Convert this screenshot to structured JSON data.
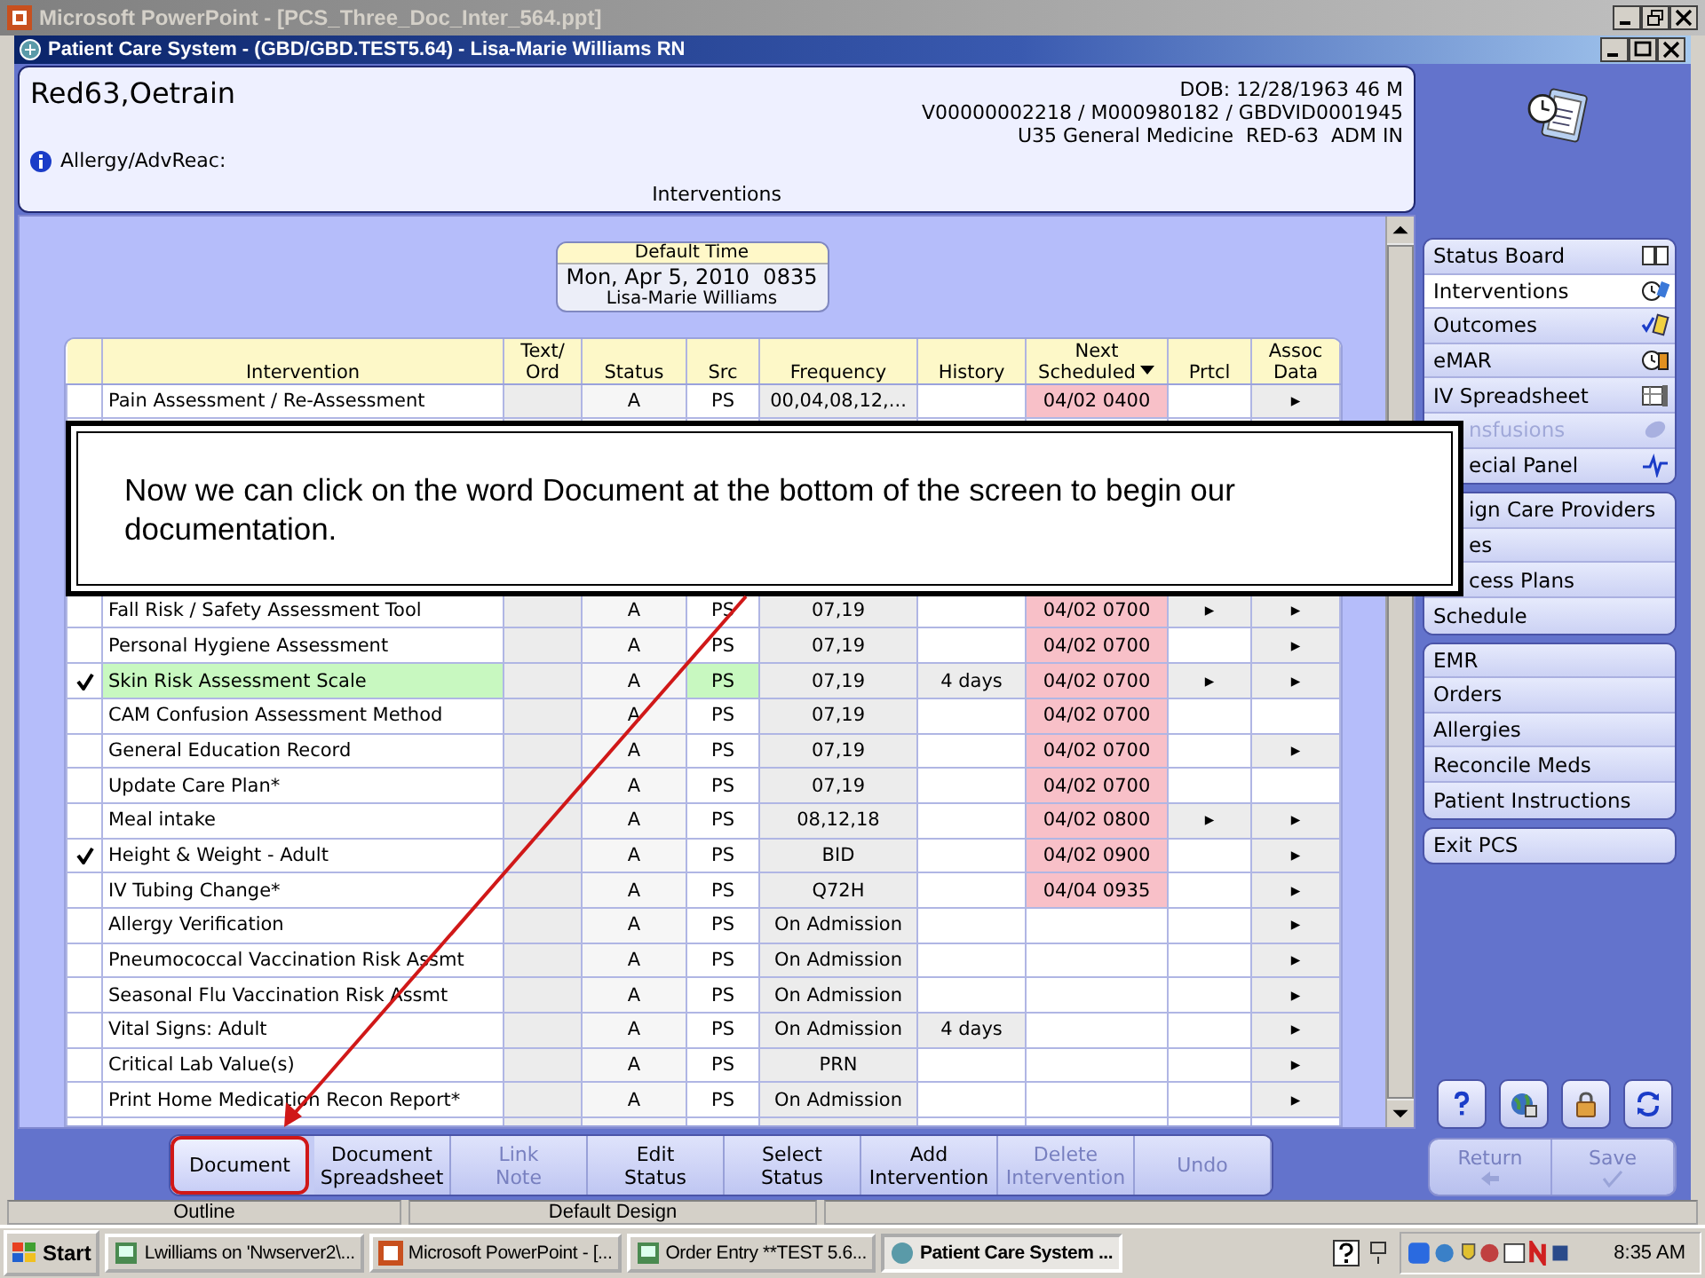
{
  "ppt_window": {
    "title": "Microsoft PowerPoint - [PCS_Three_Doc_Inter_564.ppt]"
  },
  "app_window": {
    "title": "Patient Care System - (GBD/GBD.TEST5.64) - Lisa-Marie Williams RN"
  },
  "patient": {
    "name": "Red63,Oetrain",
    "dob": "DOB: 12/28/1963 46 M",
    "ids": "V00000002218 / M000980182 / GBDVID0001945",
    "location": "U35 General Medicine  RED-63  ADM IN",
    "allergy_label": "Allergy/AdvReac:"
  },
  "page_title": "Interventions",
  "default_time": {
    "label": "Default Time",
    "datetime": "Mon, Apr 5, 2010  0835",
    "user": "Lisa-Marie Williams"
  },
  "table": {
    "columns": [
      {
        "label": "Intervention"
      },
      {
        "label": "Text/\nOrd"
      },
      {
        "label": "Status"
      },
      {
        "label": "Src"
      },
      {
        "label": "Frequency"
      },
      {
        "label": "History"
      },
      {
        "label": "Next\nScheduled",
        "sorted": true
      },
      {
        "label": "Prtcl"
      },
      {
        "label": "Assoc\nData"
      }
    ],
    "rows": [
      {
        "checked": false,
        "selected": false,
        "intervention": "Pain Assessment / Re-Assessment",
        "status": "A",
        "src": "PS",
        "frequency": "00,04,08,12,...",
        "next_scheduled": "04/02 0400",
        "assoc_data": "▸"
      },
      {
        "checked": false,
        "selected": false,
        "intervention": "Fall Risk / Safety Assessment Tool",
        "status": "A",
        "src": "PS",
        "frequency": "07,19",
        "next_scheduled": "04/02 0700",
        "prtcl": "▸",
        "assoc_data": "▸"
      },
      {
        "checked": false,
        "selected": false,
        "intervention": "Personal Hygiene Assessment",
        "status": "A",
        "src": "PS",
        "frequency": "07,19",
        "next_scheduled": "04/02 0700",
        "assoc_data": "▸"
      },
      {
        "checked": true,
        "selected": true,
        "intervention": "Skin Risk Assessment Scale",
        "status": "A",
        "src": "PS",
        "frequency": "07,19",
        "history": "4 days",
        "next_scheduled": "04/02 0700",
        "prtcl": "▸",
        "assoc_data": "▸"
      },
      {
        "checked": false,
        "selected": false,
        "intervention": "CAM Confusion Assessment Method",
        "status": "A",
        "src": "PS",
        "frequency": "07,19",
        "next_scheduled": "04/02 0700"
      },
      {
        "checked": false,
        "selected": false,
        "intervention": "General Education Record",
        "status": "A",
        "src": "PS",
        "frequency": "07,19",
        "next_scheduled": "04/02 0700",
        "assoc_data": "▸"
      },
      {
        "checked": false,
        "selected": false,
        "intervention": "Update Care Plan*",
        "status": "A",
        "src": "PS",
        "frequency": "07,19",
        "next_scheduled": "04/02 0700"
      },
      {
        "checked": false,
        "selected": false,
        "intervention": "Meal intake",
        "status": "A",
        "src": "PS",
        "frequency": "08,12,18",
        "next_scheduled": "04/02 0800",
        "prtcl": "▸",
        "assoc_data": "▸"
      },
      {
        "checked": true,
        "selected": false,
        "intervention": "Height & Weight - Adult",
        "status": "A",
        "src": "PS",
        "frequency": "BID",
        "next_scheduled": "04/02 0900",
        "assoc_data": "▸"
      },
      {
        "checked": false,
        "selected": false,
        "intervention": "IV Tubing Change*",
        "status": "A",
        "src": "PS",
        "frequency": "Q72H",
        "next_scheduled": "04/04 0935",
        "assoc_data": "▸"
      },
      {
        "checked": false,
        "selected": false,
        "intervention": "Allergy Verification",
        "status": "A",
        "src": "PS",
        "frequency": "On Admission",
        "assoc_data": "▸"
      },
      {
        "checked": false,
        "selected": false,
        "intervention": "Pneumococcal Vaccination Risk Assmt",
        "status": "A",
        "src": "PS",
        "frequency": "On Admission",
        "assoc_data": "▸"
      },
      {
        "checked": false,
        "selected": false,
        "intervention": "Seasonal Flu Vaccination Risk Assmt",
        "status": "A",
        "src": "PS",
        "frequency": "On Admission",
        "assoc_data": "▸"
      },
      {
        "checked": false,
        "selected": false,
        "intervention": "Vital Signs: Adult",
        "status": "A",
        "src": "PS",
        "frequency": "On Admission",
        "history": "4 days",
        "assoc_data": "▸"
      },
      {
        "checked": false,
        "selected": false,
        "intervention": "Critical Lab Value(s)",
        "status": "A",
        "src": "PS",
        "frequency": "PRN",
        "assoc_data": "▸"
      },
      {
        "checked": false,
        "selected": false,
        "intervention": "Print Home Medication Recon Report*",
        "status": "A",
        "src": "PS",
        "frequency": "On Admission",
        "assoc_data": "▸"
      }
    ]
  },
  "sidebar": {
    "groups": [
      {
        "items": [
          {
            "label": "Status Board",
            "selected": false,
            "disabled": false
          },
          {
            "label": "Interventions",
            "selected": true,
            "disabled": false
          },
          {
            "label": "Outcomes",
            "selected": false,
            "disabled": false
          },
          {
            "label": "eMAR",
            "selected": false,
            "disabled": false
          },
          {
            "label": "IV Spreadsheet",
            "selected": false,
            "disabled": false
          },
          {
            "label": "nsfusions",
            "selected": false,
            "disabled": true
          },
          {
            "label": "ecial Panel",
            "selected": false,
            "disabled": false
          }
        ]
      },
      {
        "items": [
          {
            "label": "ign Care Providers",
            "selected": false,
            "disabled": false
          },
          {
            "label": "es",
            "selected": false,
            "disabled": false
          },
          {
            "label": "cess Plans",
            "selected": false,
            "disabled": false
          },
          {
            "label": "Schedule",
            "selected": false,
            "disabled": false
          }
        ]
      },
      {
        "items": [
          {
            "label": "EMR",
            "selected": false,
            "disabled": false
          },
          {
            "label": "Orders",
            "selected": false,
            "disabled": false
          },
          {
            "label": "Allergies",
            "selected": false,
            "disabled": false
          },
          {
            "label": "Reconcile Meds",
            "selected": false,
            "disabled": false
          },
          {
            "label": "Patient Instructions",
            "selected": false,
            "disabled": false
          }
        ]
      },
      {
        "items": [
          {
            "label": "Exit PCS",
            "selected": false,
            "disabled": false
          }
        ]
      }
    ]
  },
  "toolbar": {
    "buttons": [
      {
        "label": "Document",
        "disabled": false,
        "highlighted": true
      },
      {
        "label": "Document\nSpreadsheet",
        "disabled": false,
        "highlighted": false
      },
      {
        "label": "Link\nNote",
        "disabled": true,
        "highlighted": false
      },
      {
        "label": "Edit\nStatus",
        "disabled": false,
        "highlighted": false
      },
      {
        "label": "Select\nStatus",
        "disabled": false,
        "highlighted": false
      },
      {
        "label": "Add\nIntervention",
        "disabled": false,
        "highlighted": false
      },
      {
        "label": "Delete\nIntervention",
        "disabled": true,
        "highlighted": false
      },
      {
        "label": "Undo",
        "disabled": true,
        "highlighted": false
      }
    ]
  },
  "nav_buttons": [
    {
      "kind": "return",
      "label": "Return",
      "disabled": true
    },
    {
      "kind": "save",
      "label": "Save",
      "disabled": true
    }
  ],
  "callout": {
    "text": "Now we can click on the word Document at the bottom of the screen to begin our documentation."
  },
  "ppt_status_bar": [
    "Outline",
    "Default Design"
  ],
  "taskbar": {
    "start": "Start",
    "tasks": [
      {
        "label": "Lwilliams on 'Nwserver2\\...",
        "selected": false
      },
      {
        "label": "Microsoft PowerPoint - [...",
        "selected": false
      },
      {
        "label": "Order Entry **TEST 5.6...",
        "selected": false
      },
      {
        "label": "Patient Care System ...",
        "selected": true
      }
    ],
    "clock": "8:35 AM"
  }
}
